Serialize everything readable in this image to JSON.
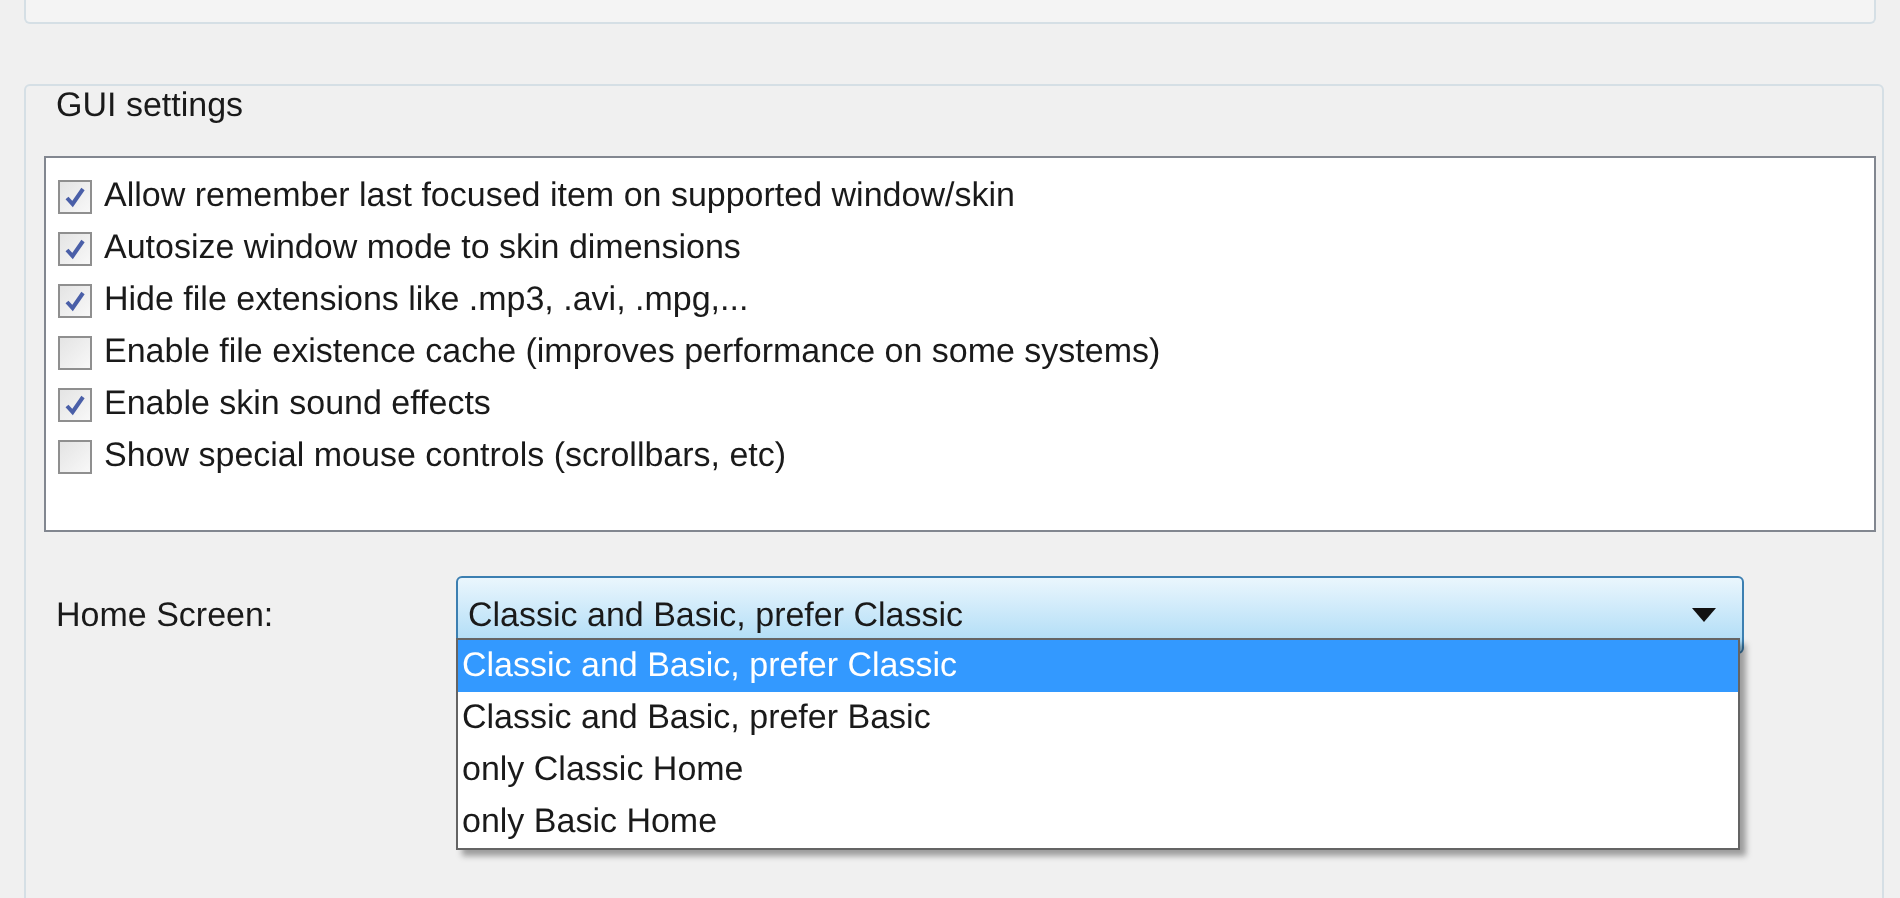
{
  "group": {
    "title": "GUI settings"
  },
  "options": [
    {
      "label": "Allow remember last focused item on supported window/skin",
      "checked": true
    },
    {
      "label": "Autosize window mode to skin dimensions",
      "checked": true
    },
    {
      "label": "Hide file extensions like .mp3, .avi, .mpg,...",
      "checked": true
    },
    {
      "label": "Enable file existence cache (improves performance on some systems)",
      "checked": false
    },
    {
      "label": "Enable skin sound effects",
      "checked": true
    },
    {
      "label": "Show special mouse controls (scrollbars, etc)",
      "checked": false
    }
  ],
  "home_screen": {
    "label": "Home Screen:",
    "value": "Classic and Basic, prefer Classic",
    "expanded": true,
    "items": [
      {
        "label": "Classic and Basic, prefer Classic",
        "selected": true
      },
      {
        "label": "Classic and Basic, prefer Basic",
        "selected": false
      },
      {
        "label": "only Classic Home",
        "selected": false
      },
      {
        "label": "only Basic Home",
        "selected": false
      }
    ]
  }
}
